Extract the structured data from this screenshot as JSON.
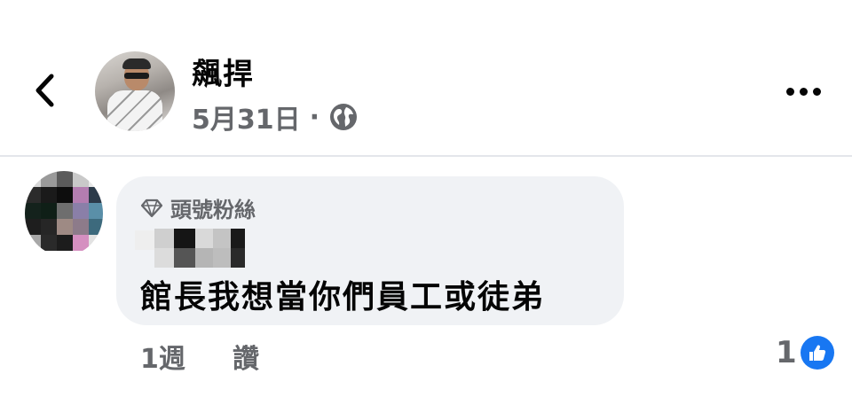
{
  "post": {
    "page_name": "飆捍",
    "date": "5月31日",
    "separator": "·",
    "privacy_icon": "globe-icon"
  },
  "header": {
    "back_icon": "chevron-left-icon",
    "more_icon": "more-horizontal-icon"
  },
  "comment": {
    "badge_icon": "diamond-icon",
    "badge_label": "頭號粉絲",
    "text": "館長我想當你們員工或徒弟",
    "time": "1週",
    "like_label": "讚",
    "reaction_count": "1",
    "reaction_icon": "thumbs-up-icon"
  },
  "colors": {
    "primary_text": "#050505",
    "secondary_text": "#65676b",
    "bubble_bg": "#f0f2f5",
    "like_blue": "#1877f2",
    "divider": "#e4e6eb"
  }
}
